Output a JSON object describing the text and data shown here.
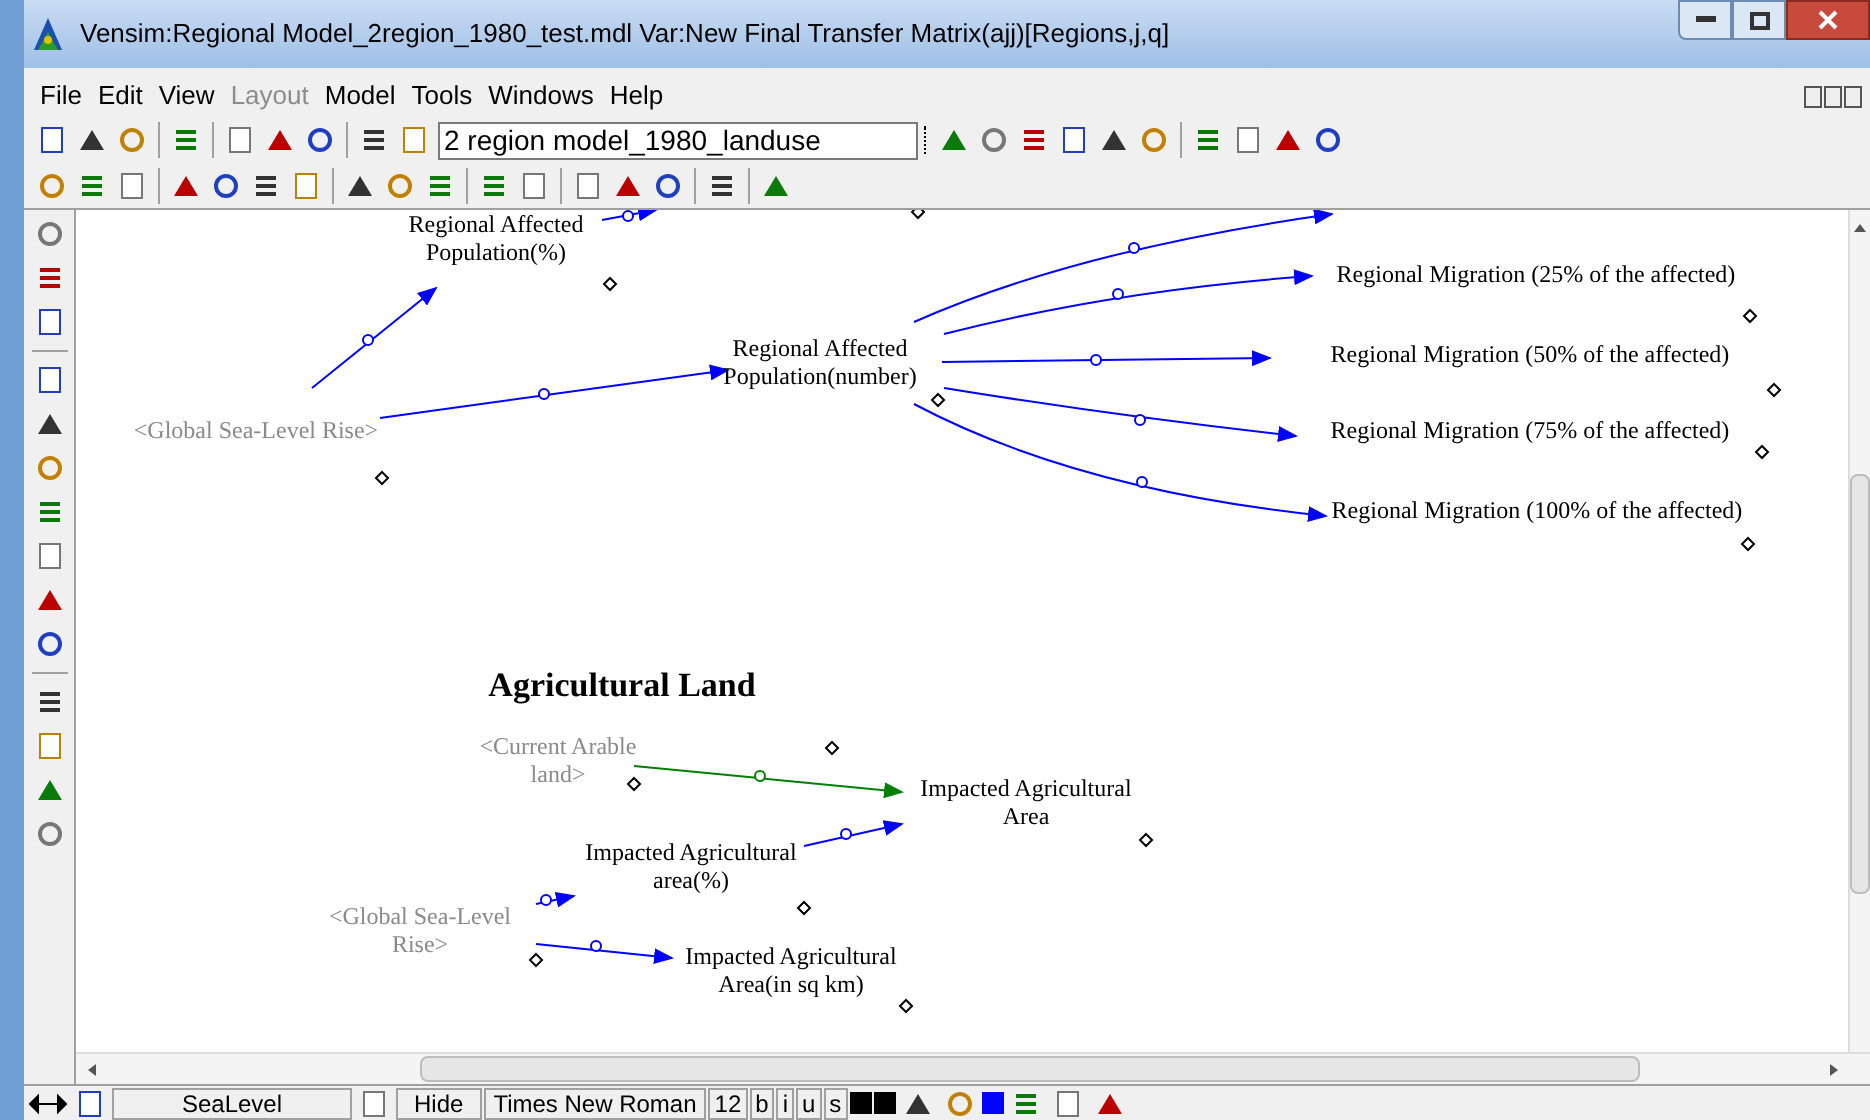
{
  "window": {
    "title": "Vensim:Regional Model_2region_1980_test.mdl Var:New Final Transfer Matrix(ajj)[Regions,j,q]"
  },
  "menu": [
    {
      "label": "File",
      "disabled": false
    },
    {
      "label": "Edit",
      "disabled": false
    },
    {
      "label": "View",
      "disabled": false
    },
    {
      "label": "Layout",
      "disabled": true
    },
    {
      "label": "Model",
      "disabled": false
    },
    {
      "label": "Tools",
      "disabled": false
    },
    {
      "label": "Windows",
      "disabled": false
    },
    {
      "label": "Help",
      "disabled": false
    }
  ],
  "model_selector": {
    "value": "2 region model_1980_landuse"
  },
  "diagram": {
    "nodes": [
      {
        "kind": "variable",
        "text": "Regional Affected Population(%)"
      },
      {
        "kind": "variable",
        "text": "Regional Affected Population(number)"
      },
      {
        "kind": "shadow",
        "text": "<Global Sea-Level Rise>"
      },
      {
        "kind": "variable",
        "text": "Regional Migration (25% of the affected)"
      },
      {
        "kind": "variable",
        "text": "Regional Migration (50% of the affected)"
      },
      {
        "kind": "variable",
        "text": "Regional Migration (75% of the affected)"
      },
      {
        "kind": "variable",
        "text": "Regional Migration (100% of the affected)"
      },
      {
        "kind": "heading",
        "text": "Agricultural Land"
      },
      {
        "kind": "shadow",
        "text": "<Current Arable land>"
      },
      {
        "kind": "variable",
        "text": "Impacted Agricultural Area"
      },
      {
        "kind": "variable",
        "text": "Impacted Agricultural area(%)"
      },
      {
        "kind": "shadow",
        "text": "<Global Sea-Level Rise>"
      },
      {
        "kind": "variable",
        "text": "Impacted Agricultural Area(in sq km)"
      }
    ],
    "links": [
      {
        "color": "#0000ff"
      },
      {
        "color": "#0000ff"
      },
      {
        "color": "#0000ff"
      },
      {
        "color": "#0000ff"
      },
      {
        "color": "#0000ff"
      },
      {
        "color": "#0000ff"
      },
      {
        "color": "#0000ff"
      },
      {
        "color": "#0000ff"
      },
      {
        "color": "#008000"
      },
      {
        "color": "#0000ff"
      },
      {
        "color": "#0000ff"
      },
      {
        "color": "#0000ff"
      }
    ]
  },
  "status_bar": {
    "variable": "SeaLevel",
    "visibility": "Hide",
    "font": "Times New Roman",
    "size": "12",
    "styles": [
      "b",
      "i",
      "u",
      "s"
    ]
  }
}
